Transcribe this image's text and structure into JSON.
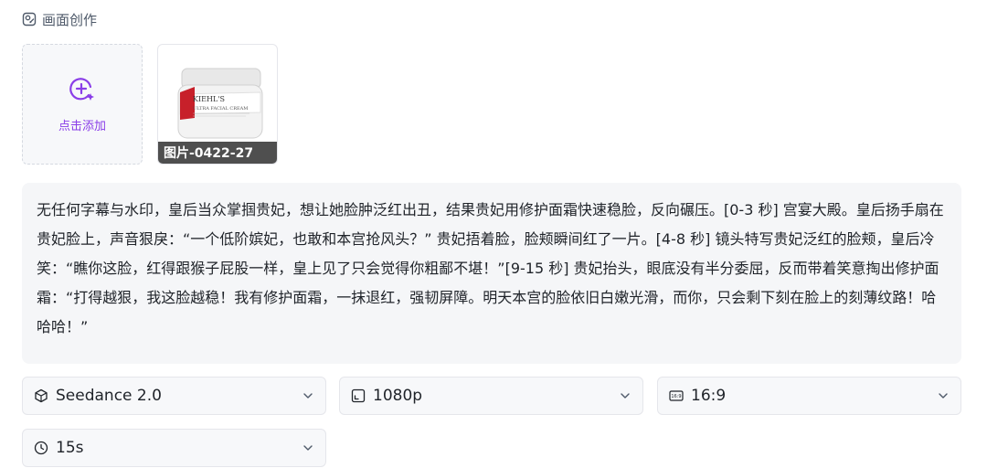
{
  "header": {
    "title": "画面创作",
    "icon": "image-edit-icon"
  },
  "upload": {
    "add_label": "点击添加",
    "icon": "add-sparkle-icon"
  },
  "thumbnail": {
    "caption": "图片-0422-27",
    "product_label": "KIEHL'S",
    "product_sub": "ULTRA FACIAL CREAM"
  },
  "prompt": {
    "text": "无任何字幕与水印，皇后当众掌掴贵妃，想让她脸肿泛红出丑，结果贵妃用修护面霜快速稳脸，反向碾压。[0-3 秒] 宫宴大殿。皇后扬手扇在贵妃脸上，声音狠戾：“一个低阶嫔妃，也敢和本宫抢风头？” 贵妃捂着脸，脸颊瞬间红了一片。[4-8 秒] 镜头特写贵妃泛红的脸颊，皇后冷笑：“瞧你这脸，红得跟猴子屁股一样，皇上见了只会觉得你粗鄙不堪！”[9-15 秒] 贵妃抬头，眼底没有半分委屈，反而带着笑意掏出修护面霜：“打得越狠，我这脸越稳！我有修护面霜，一抹退红，强韧屏障。明天本宫的脸依旧白嫩光滑，而你，只会剩下刻在脸上的刻薄纹路！哈哈哈！”"
  },
  "selects": {
    "model": {
      "value": "Seedance 2.0",
      "icon": "cube-icon"
    },
    "resolution": {
      "value": "1080p",
      "icon": "resolution-icon"
    },
    "ratio": {
      "value": "16:9",
      "icon": "aspect-ratio-icon",
      "icon_text": "16:9"
    },
    "duration": {
      "value": "15s",
      "icon": "clock-icon"
    }
  },
  "colors": {
    "accent": "#8a3ee8",
    "panel": "#f5f6f8",
    "border": "#e5e6eb"
  }
}
